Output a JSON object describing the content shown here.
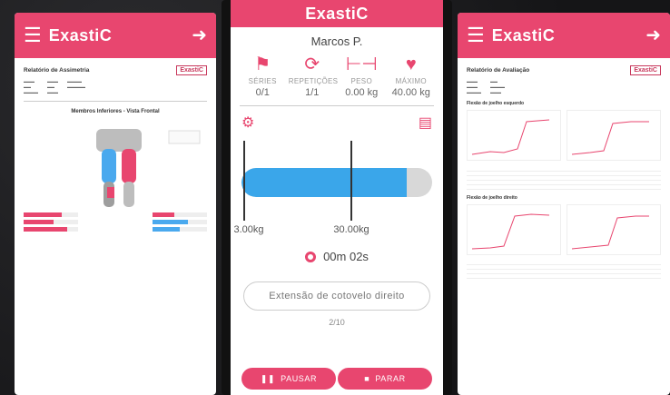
{
  "left": {
    "logo": "ExastiC",
    "report_title": "Relatório de Assimetria",
    "report_logo": "ExastiC",
    "chart_title": "Membros Inferiores - Vista Frontal"
  },
  "middle": {
    "logo": "ExastiC",
    "patient": "Marcos P.",
    "stats": [
      {
        "label": "SÉRIES",
        "value": "0/1"
      },
      {
        "label": "REPETIÇÕES",
        "value": "1/1"
      },
      {
        "label": "PESO",
        "value": "0.00 kg"
      },
      {
        "label": "MÁXIMO",
        "value": "40.00 kg"
      }
    ],
    "gauge": {
      "min_label": "3.00kg",
      "max_label": "30.00kg",
      "fill_fraction": 0.865
    },
    "timer": "00m 02s",
    "exercise": "Extensão de cotovelo direito",
    "count": "2/10",
    "pause_label": "PAUSAR",
    "stop_label": "PARAR"
  },
  "right": {
    "logo": "ExastiC",
    "report_title": "Relatório de Avaliação",
    "report_logo": "ExastiC",
    "section1": "Flexão de joelho esquerdo",
    "section2": "Flexão de joelho direito"
  },
  "colors": {
    "accent": "#e8466f",
    "blue": "#3aa6ea"
  }
}
